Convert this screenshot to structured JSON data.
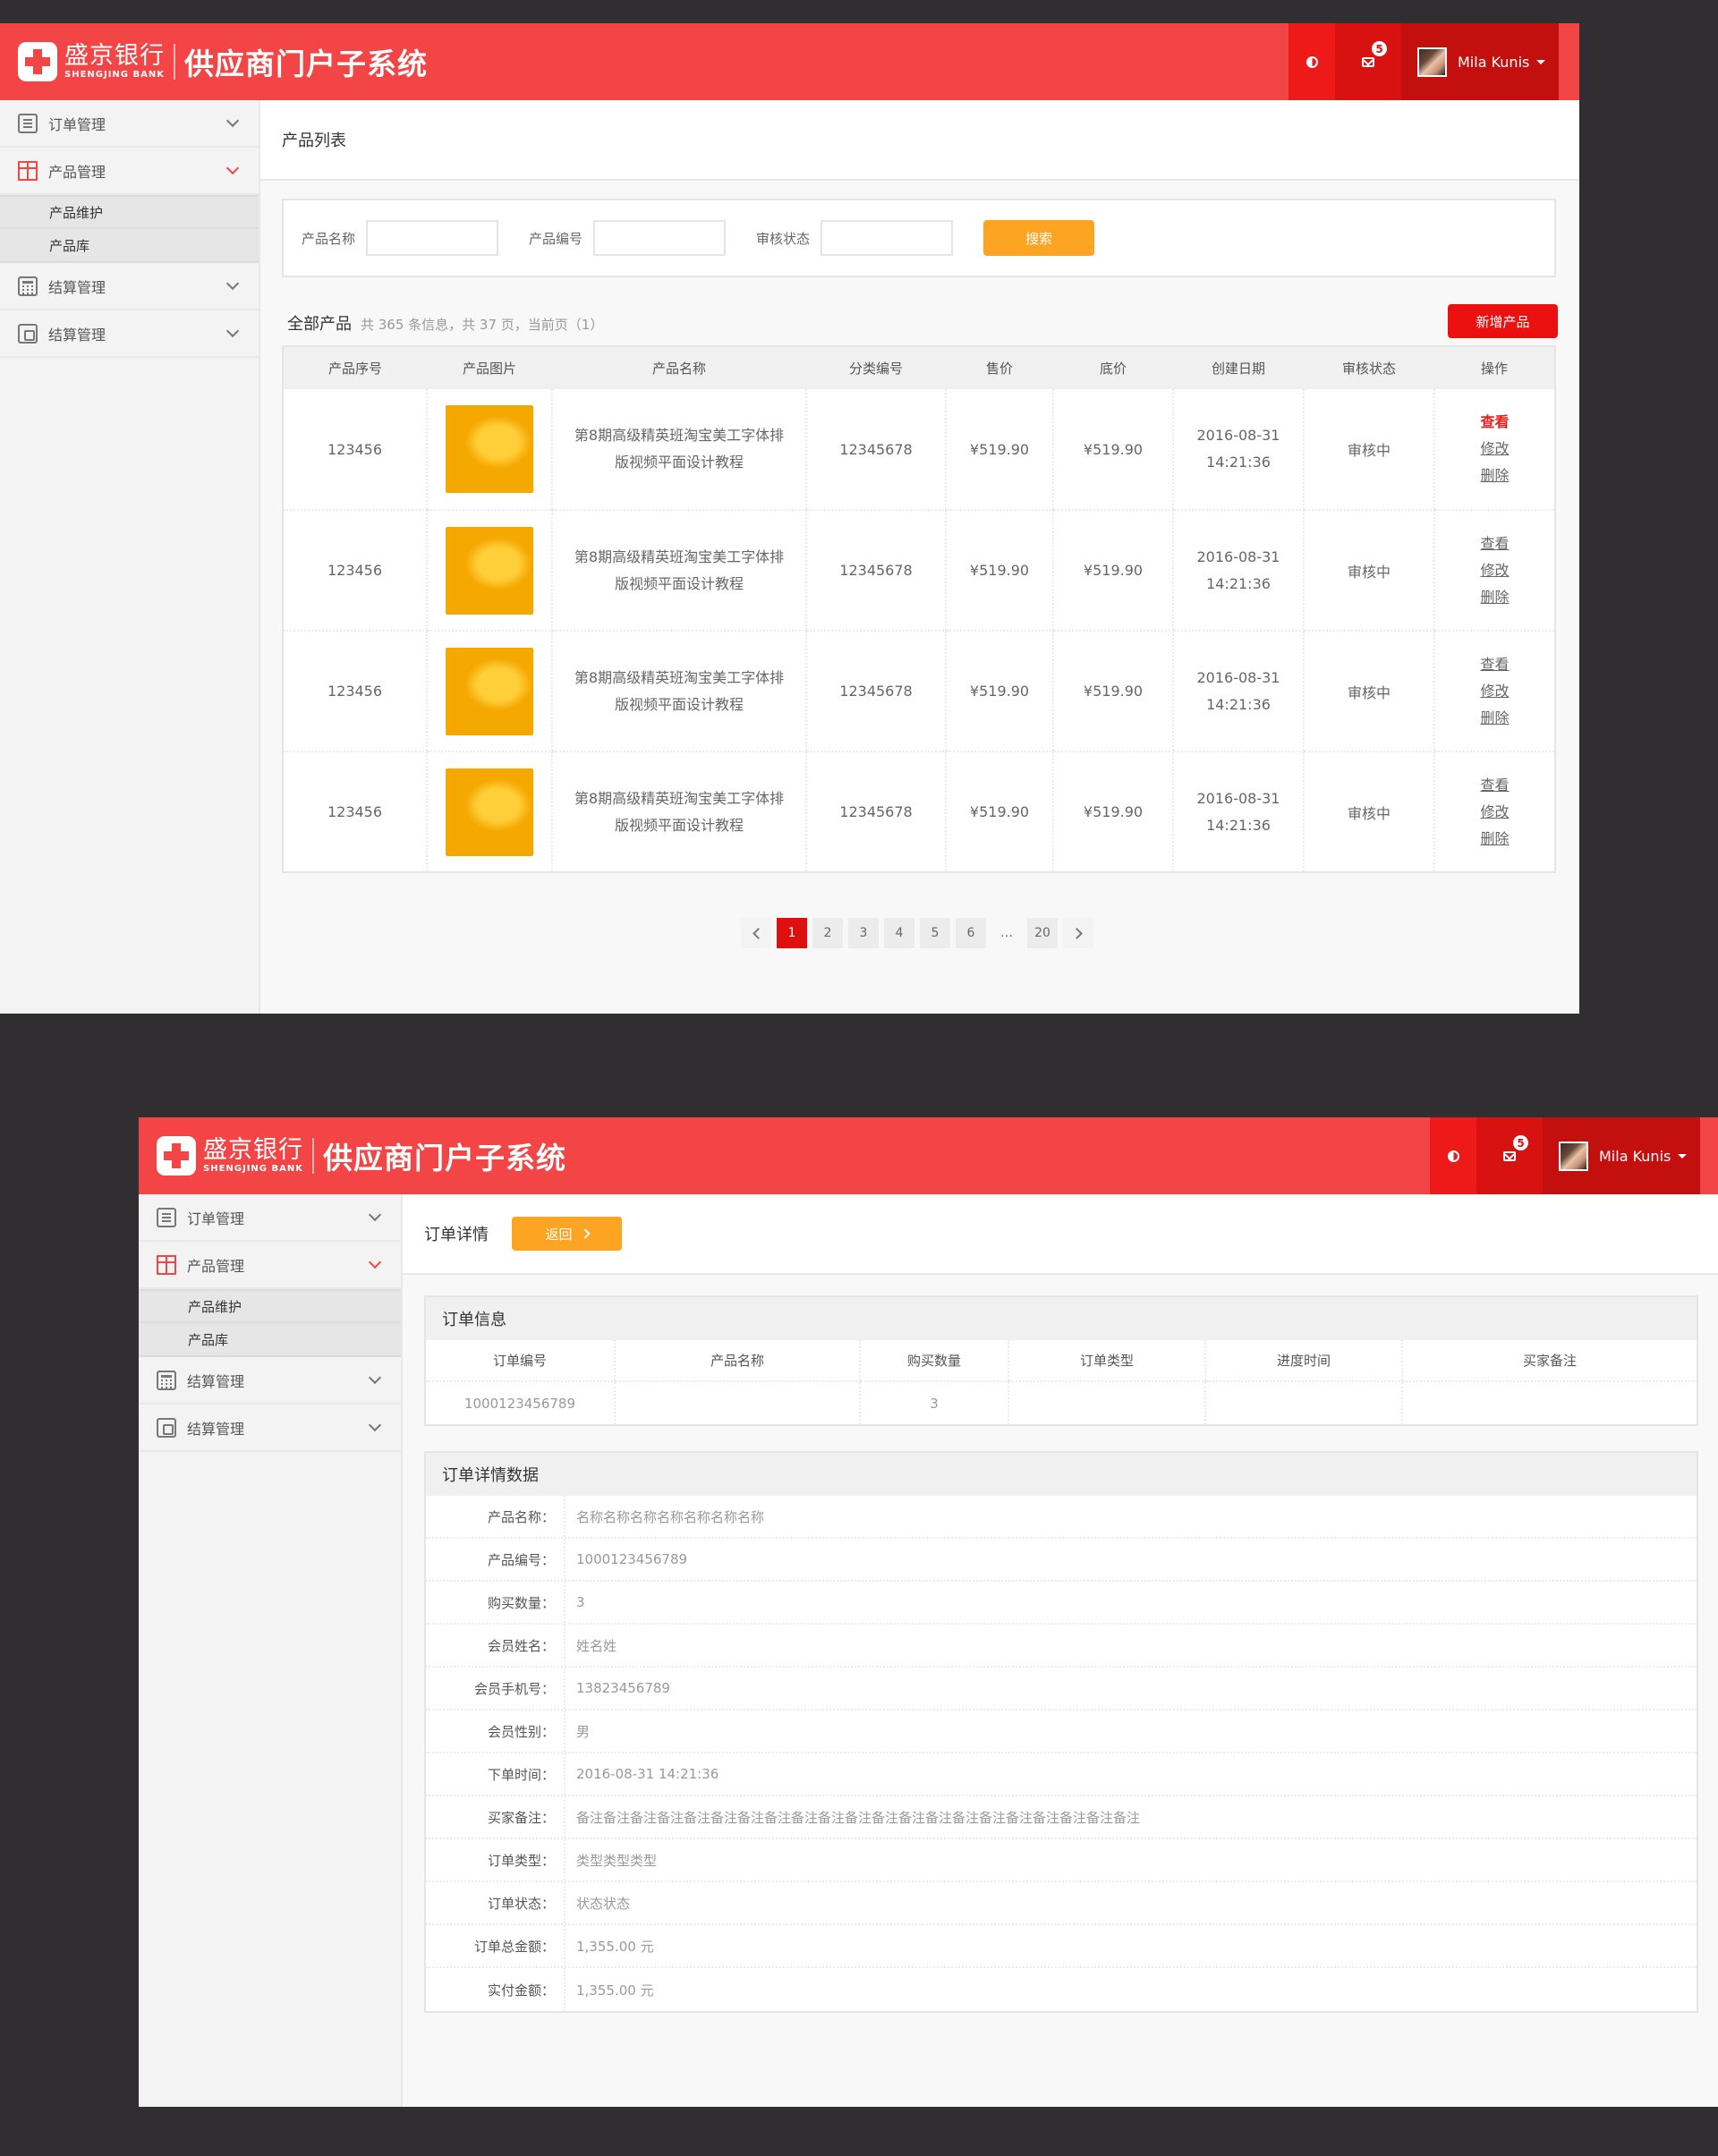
{
  "brand": {
    "bank_cn": "盛京银行",
    "bank_en": "SHENGJING BANK",
    "system": "供应商门户子系统"
  },
  "header": {
    "contrast_icon": "contrast-icon",
    "mail_icon": "mail-icon",
    "mail_badge": "5",
    "user_name": "Mila Kunis",
    "colors": {
      "bar": "#f34545",
      "contrast_bg": "#ee1a1a",
      "mail_bg": "#d81111",
      "user_bg": "#c40f0f"
    }
  },
  "sidebar": {
    "items": [
      {
        "label": "订单管理",
        "icon": "clipboard-icon",
        "expanded": false
      },
      {
        "label": "产品管理",
        "icon": "gift-icon",
        "expanded": true,
        "children": [
          "产品维护",
          "产品库"
        ]
      },
      {
        "label": "结算管理",
        "icon": "calculator-icon",
        "expanded": false
      },
      {
        "label": "结算管理",
        "icon": "invoice-icon",
        "expanded": false
      }
    ]
  },
  "product_list": {
    "page_title": "产品列表",
    "search": {
      "name_label": "产品名称",
      "name_value": "",
      "code_label": "产品编号",
      "code_value": "",
      "status_label": "审核状态",
      "status_value": "",
      "button": "搜索"
    },
    "list_title": "全部产品",
    "list_info": "共 365 条信息，共 37 页，当前页（1）",
    "add_button": "新增产品",
    "columns": [
      "产品序号",
      "产品图片",
      "产品名称",
      "分类编号",
      "售价",
      "底价",
      "创建日期",
      "审核状态",
      "操作"
    ],
    "rows": [
      {
        "id": "123456",
        "image": "canned-peach-image",
        "name": "第8期高级精英班淘宝美工字体排版视频平面设计教程",
        "category": "12345678",
        "price": "¥519.90",
        "floor_price": "¥519.90",
        "date": "2016-08-31",
        "time": "14:21:36",
        "status": "审核中",
        "ops": [
          "查看",
          "修改",
          "删除"
        ]
      },
      {
        "id": "123456",
        "image": "canned-peach-image",
        "name": "第8期高级精英班淘宝美工字体排版视频平面设计教程",
        "category": "12345678",
        "price": "¥519.90",
        "floor_price": "¥519.90",
        "date": "2016-08-31",
        "time": "14:21:36",
        "status": "审核中",
        "ops": [
          "查看",
          "修改",
          "删除"
        ]
      },
      {
        "id": "123456",
        "image": "canned-peach-image",
        "name": "第8期高级精英班淘宝美工字体排版视频平面设计教程",
        "category": "12345678",
        "price": "¥519.90",
        "floor_price": "¥519.90",
        "date": "2016-08-31",
        "time": "14:21:36",
        "status": "审核中",
        "ops": [
          "查看",
          "修改",
          "删除"
        ]
      },
      {
        "id": "123456",
        "image": "canned-peach-image",
        "name": "第8期高级精英班淘宝美工字体排版视频平面设计教程",
        "category": "12345678",
        "price": "¥519.90",
        "floor_price": "¥519.90",
        "date": "2016-08-31",
        "time": "14:21:36",
        "status": "审核中",
        "ops": [
          "查看",
          "修改",
          "删除"
        ]
      }
    ],
    "pagination": {
      "pages": [
        "1",
        "2",
        "3",
        "4",
        "5",
        "6",
        "…",
        "20"
      ],
      "current": "1"
    }
  },
  "order_detail": {
    "page_title": "订单详情",
    "back_button": "返回",
    "info_card": {
      "title": "订单信息",
      "columns": [
        "订单编号",
        "产品名称",
        "购买数量",
        "订单类型",
        "进度时间",
        "买家备注"
      ],
      "row": [
        "1000123456789",
        "",
        "3",
        "",
        "",
        ""
      ]
    },
    "detail_card": {
      "title": "订单详情数据",
      "fields": [
        {
          "label": "产品名称：",
          "value": "名称名称名称名称名称名称名称"
        },
        {
          "label": "产品编号：",
          "value": "1000123456789"
        },
        {
          "label": "购买数量：",
          "value": "3"
        },
        {
          "label": "会员姓名：",
          "value": "姓名姓"
        },
        {
          "label": "会员手机号：",
          "value": "13823456789"
        },
        {
          "label": "会员性别：",
          "value": "男"
        },
        {
          "label": "下单时间：",
          "value": "2016-08-31 14:21:36"
        },
        {
          "label": "买家备注：",
          "value": "备注备注备注备注备注备注备注备注备注备注备注备注备注备注备注备注备注备注备注备注备注"
        },
        {
          "label": "订单类型：",
          "value": "类型类型类型"
        },
        {
          "label": "订单状态：",
          "value": "状态状态"
        },
        {
          "label": "订单总金额：",
          "value": "1,355.00 元"
        },
        {
          "label": "实付金额：",
          "value": "1,355.00 元"
        }
      ]
    }
  }
}
